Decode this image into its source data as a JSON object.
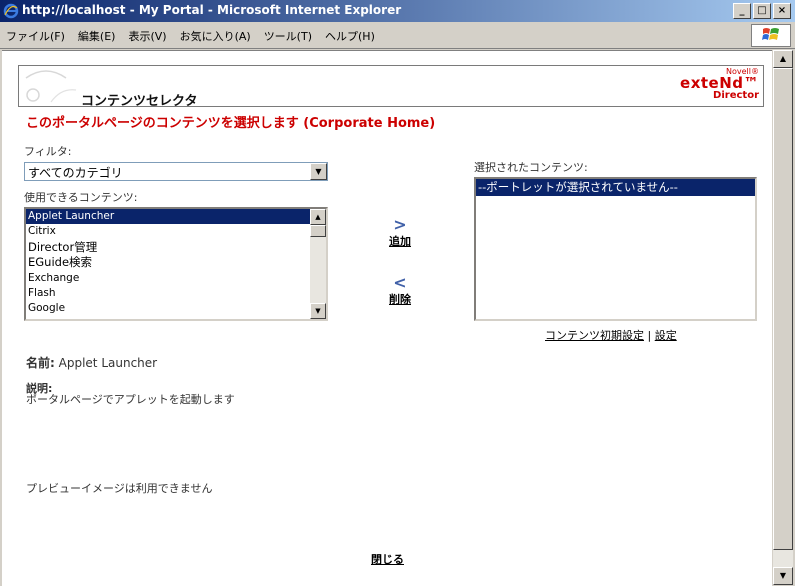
{
  "window": {
    "title": "http://localhost - My Portal - Microsoft Internet Explorer",
    "controls": [
      "_",
      "□",
      "×"
    ]
  },
  "menu": {
    "items": [
      "ファイル(F)",
      "編集(E)",
      "表示(V)",
      "お気に入り(A)",
      "ツール(T)",
      "ヘルプ(H)"
    ]
  },
  "header": {
    "title": "コンテンツセレクタ",
    "brand_small": "Novell®",
    "brand_main": "exteNd™",
    "brand_sub": "Director"
  },
  "heading": "このポータルページのコンテンツを選択します (Corporate Home)",
  "filter": {
    "label": "フィルタ:",
    "selected": "すべてのカテゴリ"
  },
  "available": {
    "label": "使用できるコンテンツ:",
    "items": [
      "Applet Launcher",
      "Citrix",
      "Director管理",
      "EGuide検索",
      "Exchange",
      "Flash",
      "Google"
    ],
    "selected_index": 0
  },
  "actions": {
    "add_label": "追加",
    "remove_label": "削除"
  },
  "selected": {
    "label": "選択されたコンテンツ:",
    "items": [
      "--ポートレットが選択されていません--"
    ]
  },
  "links": {
    "defaults": "コンテンツ初期設定",
    "separator": "|",
    "settings": "設定"
  },
  "details": {
    "name_label": "名前:",
    "name_value": "Applet Launcher",
    "desc_label": "説明:",
    "desc_value": "ポータルページでアプレットを起動します",
    "preview": "プレビューイメージは利用できません"
  },
  "close_label": "閉じる",
  "colors": {
    "title_start": "#0a246a",
    "heading": "#cc0000",
    "selection": "#0a246a"
  }
}
